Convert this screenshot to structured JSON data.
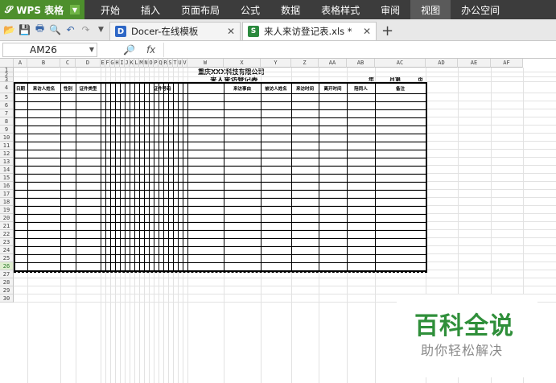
{
  "app": {
    "name": "WPS 表格"
  },
  "menu": [
    "开始",
    "插入",
    "页面布局",
    "公式",
    "数据",
    "表格样式",
    "审阅",
    "视图",
    "办公空间"
  ],
  "active_menu": "视图",
  "tabs": [
    {
      "label": "Docer-在线模板",
      "icon": "docer-icon"
    },
    {
      "label": "来人来访登记表.xls *",
      "icon": "xls-icon"
    }
  ],
  "formula_bar": {
    "cell_ref": "AM26",
    "fx": "fx",
    "value": ""
  },
  "sheet": {
    "columns": [
      "A",
      "B",
      "C",
      "D",
      "E",
      "F",
      "G",
      "H",
      "I",
      "J",
      "K",
      "L",
      "M",
      "N",
      "O",
      "P",
      "Q",
      "R",
      "S",
      "T",
      "U",
      "V",
      "W",
      "X",
      "Y",
      "Z",
      "AA",
      "AB",
      "AC",
      "AD",
      "AE",
      "AF"
    ],
    "rows": [
      "1",
      "2",
      "3",
      "4",
      "5",
      "6",
      "7",
      "8",
      "9",
      "10",
      "11",
      "12",
      "13",
      "14",
      "15",
      "16",
      "17",
      "18",
      "19",
      "20",
      "21",
      "22",
      "23",
      "24",
      "25",
      "26",
      "27",
      "28",
      "29",
      "30"
    ],
    "selected_row": "26",
    "company": "重庆XXX科技有限公司",
    "title": "来人来访登记表",
    "year_label": "年",
    "month_page_label": "月第",
    "page_label": "页",
    "headers": [
      "日期",
      "来访人姓名",
      "性别",
      "证件类型",
      "证件号码",
      "来访事由",
      "被访人姓名",
      "来访时间",
      "离开时间",
      "陪同人",
      "备注"
    ]
  },
  "watermark": {
    "title": "百科全说",
    "subtitle": "助你轻松解决"
  }
}
